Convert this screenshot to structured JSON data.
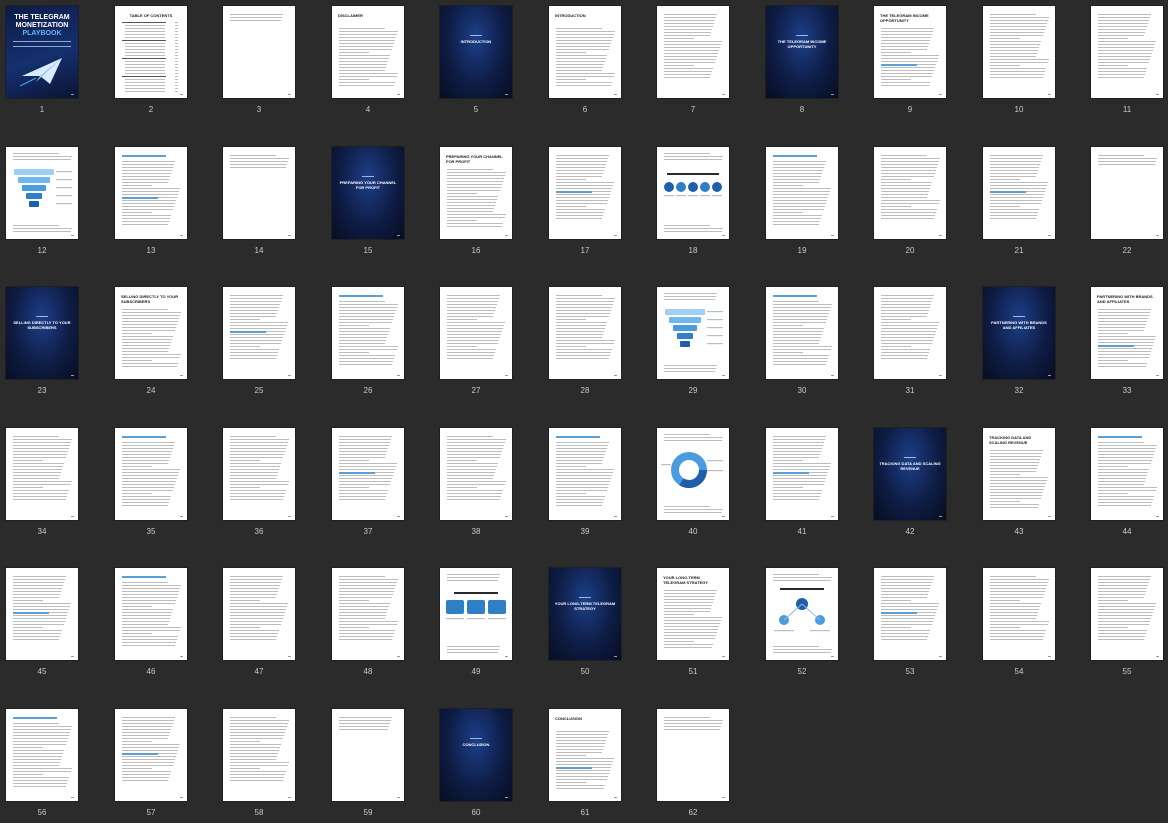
{
  "cover": {
    "title_line1": "THE TELEGRAM",
    "title_line2": "MONETIZATION",
    "title_line3": "PLAYBOOK"
  },
  "pages": [
    {
      "number": "1",
      "kind": "cover"
    },
    {
      "number": "2",
      "kind": "toc",
      "title": "TABLE OF CONTENTS"
    },
    {
      "number": "3",
      "kind": "short"
    },
    {
      "number": "4",
      "kind": "text",
      "title": "DISCLAIMER"
    },
    {
      "number": "5",
      "kind": "chapter",
      "label": "INTRODUCTION"
    },
    {
      "number": "6",
      "kind": "text",
      "title": "INTRODUCTION"
    },
    {
      "number": "7",
      "kind": "text"
    },
    {
      "number": "8",
      "kind": "chapter",
      "label": "THE TELEGRAM INCOME OPPORTUNITY"
    },
    {
      "number": "9",
      "kind": "text",
      "title": "THE TELEGRAM INCOME OPPORTUNITY"
    },
    {
      "number": "10",
      "kind": "text"
    },
    {
      "number": "11",
      "kind": "text"
    },
    {
      "number": "12",
      "kind": "figure",
      "fig": "funnel"
    },
    {
      "number": "13",
      "kind": "text",
      "heading": true
    },
    {
      "number": "14",
      "kind": "short"
    },
    {
      "number": "15",
      "kind": "chapter",
      "label": "PREPARING YOUR CHANNEL FOR PROFIT"
    },
    {
      "number": "16",
      "kind": "text",
      "title": "PREPARING YOUR CHANNEL FOR PROFIT"
    },
    {
      "number": "17",
      "kind": "text"
    },
    {
      "number": "18",
      "kind": "figure",
      "fig": "circles"
    },
    {
      "number": "19",
      "kind": "text",
      "heading": true
    },
    {
      "number": "20",
      "kind": "text"
    },
    {
      "number": "21",
      "kind": "text"
    },
    {
      "number": "22",
      "kind": "short"
    },
    {
      "number": "23",
      "kind": "chapter",
      "label": "SELLING DIRECTLY TO YOUR SUBSCRIBERS"
    },
    {
      "number": "24",
      "kind": "text",
      "title": "SELLING DIRECTLY TO YOUR SUBSCRIBERS"
    },
    {
      "number": "25",
      "kind": "text"
    },
    {
      "number": "26",
      "kind": "text",
      "heading": true
    },
    {
      "number": "27",
      "kind": "text"
    },
    {
      "number": "28",
      "kind": "text"
    },
    {
      "number": "29",
      "kind": "figure",
      "fig": "funnel"
    },
    {
      "number": "30",
      "kind": "text",
      "heading": true
    },
    {
      "number": "31",
      "kind": "text"
    },
    {
      "number": "32",
      "kind": "chapter",
      "label": "PARTNERING WITH BRANDS AND AFFILIATES"
    },
    {
      "number": "33",
      "kind": "text",
      "title": "PARTNERING WITH BRANDS AND AFFILIATES"
    },
    {
      "number": "34",
      "kind": "text"
    },
    {
      "number": "35",
      "kind": "text",
      "heading": true
    },
    {
      "number": "36",
      "kind": "text"
    },
    {
      "number": "37",
      "kind": "text"
    },
    {
      "number": "38",
      "kind": "text"
    },
    {
      "number": "39",
      "kind": "text",
      "heading": true
    },
    {
      "number": "40",
      "kind": "figure",
      "fig": "donut"
    },
    {
      "number": "41",
      "kind": "text"
    },
    {
      "number": "42",
      "kind": "chapter",
      "label": "TRACKING DATA AND SCALING REVENUE"
    },
    {
      "number": "43",
      "kind": "text",
      "title": "TRACKING DATA AND SCALING REVENUE"
    },
    {
      "number": "44",
      "kind": "text",
      "heading": true
    },
    {
      "number": "45",
      "kind": "text"
    },
    {
      "number": "46",
      "kind": "text",
      "heading": true
    },
    {
      "number": "47",
      "kind": "text"
    },
    {
      "number": "48",
      "kind": "text"
    },
    {
      "number": "49",
      "kind": "figure",
      "fig": "boxes"
    },
    {
      "number": "50",
      "kind": "chapter",
      "label": "YOUR LONG-TERM TELEGRAM STRATEGY"
    },
    {
      "number": "51",
      "kind": "text",
      "title": "YOUR LONG-TERM TELEGRAM STRATEGY"
    },
    {
      "number": "52",
      "kind": "figure",
      "fig": "timeline"
    },
    {
      "number": "53",
      "kind": "text"
    },
    {
      "number": "54",
      "kind": "text"
    },
    {
      "number": "55",
      "kind": "text"
    },
    {
      "number": "56",
      "kind": "text",
      "heading": true
    },
    {
      "number": "57",
      "kind": "text"
    },
    {
      "number": "58",
      "kind": "text"
    },
    {
      "number": "59",
      "kind": "short"
    },
    {
      "number": "60",
      "kind": "chapter",
      "label": "CONCLUSION"
    },
    {
      "number": "61",
      "kind": "text",
      "title": "CONCLUSION"
    },
    {
      "number": "62",
      "kind": "short"
    }
  ]
}
